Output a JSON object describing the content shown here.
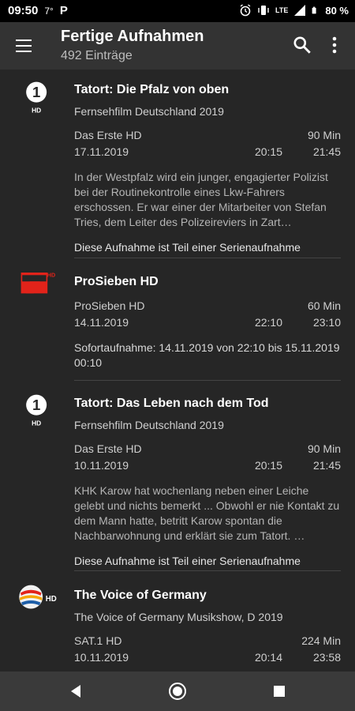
{
  "status": {
    "time": "09:50",
    "temp": "7°",
    "app_letter": "P",
    "network": "LTE",
    "battery": "80 %"
  },
  "appbar": {
    "title": "Fertige Aufnahmen",
    "subtitle": "492 Einträge"
  },
  "items": [
    {
      "logo": "das-erste-logo",
      "title": "Tatort: Die Pfalz von oben",
      "subtitle": "Fernsehfilm Deutschland 2019",
      "channel": "Das Erste HD",
      "duration": "90 Min",
      "date": "17.11.2019",
      "start": "20:15",
      "end": "21:45",
      "desc": "In der Westpfalz wird ein junger, engagierter Polizist bei der Routinekontrolle eines Lkw-Fahrers erschossen. Er war einer der Mitarbeiter von Stefan Tries, dem Leiter des Polizeireviers in Zart…",
      "note": "Diese Aufnahme ist Teil einer Serienaufnahme"
    },
    {
      "logo": "prosieben-logo",
      "title": "ProSieben HD",
      "channel": "ProSieben HD",
      "duration": "60 Min",
      "date": "14.11.2019",
      "start": "22:10",
      "end": "23:10",
      "desc": "Sofortaufnahme: 14.11.2019 von 22:10 bis 15.11.2019 00:10"
    },
    {
      "logo": "das-erste-logo",
      "title": "Tatort: Das Leben nach dem Tod",
      "subtitle": "Fernsehfilm Deutschland 2019",
      "channel": "Das Erste HD",
      "duration": "90 Min",
      "date": "10.11.2019",
      "start": "20:15",
      "end": "21:45",
      "desc": "KHK Karow hat wochenlang neben einer Leiche gelebt und nichts bemerkt ... Obwohl er nie Kontakt zu dem Mann hatte, betritt Karow spontan die Nachbarwohnung und erklärt sie zum Tatort. …",
      "note": "Diese Aufnahme ist Teil einer Serienaufnahme"
    },
    {
      "logo": "sat1-logo",
      "title": "The Voice of Germany",
      "subtitle": "The Voice of Germany Musikshow, D 2019",
      "channel": "SAT.1 HD",
      "duration": "224 Min",
      "date": "10.11.2019",
      "start": "20:14",
      "end": "23:58"
    }
  ],
  "logos": {
    "das_erste_num": "1",
    "hd": "HD"
  },
  "colors": {
    "appbar": "#333333",
    "background": "#262626",
    "prosieben_red": "#e2231a"
  }
}
